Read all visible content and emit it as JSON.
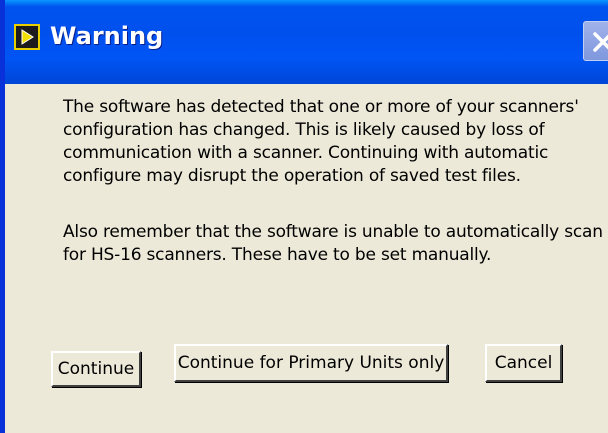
{
  "window": {
    "title": "Warning"
  },
  "icons": {
    "app": "labview-run-icon",
    "close": "close-icon"
  },
  "message": {
    "paragraph1": "The software has detected that one or more of your scanners'\nconfiguration has changed.  This is likely caused by loss of\ncommunication with a scanner.  Continuing with automatic\nconfigure may disrupt the operation of saved test files.",
    "paragraph2": "Also remember that the software is unable to automatically scan\nfor HS-16 scanners.  These have to be set manually."
  },
  "buttons": {
    "continue": "Continue",
    "continue_primary": "Continue for Primary Units only",
    "cancel": "Cancel"
  },
  "colors": {
    "titlebar": "#0053ee",
    "window_bg": "#ece9d8",
    "frame": "#0831d9"
  }
}
